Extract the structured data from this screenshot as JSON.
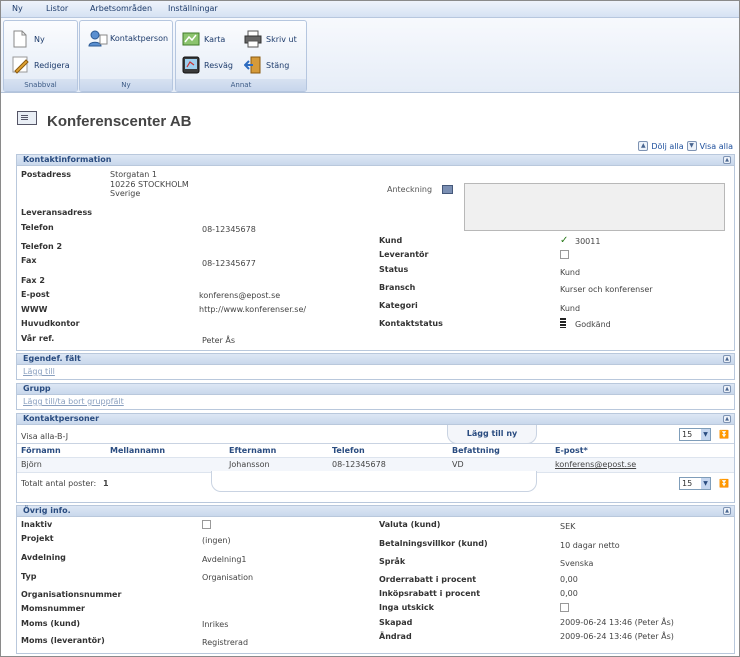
{
  "menu": [
    "Ny",
    "Listor",
    "Arbetsområden",
    "Inställningar"
  ],
  "ribbon": {
    "snabbval": {
      "label": "Snabbval",
      "new": "Ny",
      "edit": "Redigera"
    },
    "ny": {
      "label": "Ny",
      "contact": "Kontaktperson"
    },
    "annat": {
      "label": "Annat",
      "map": "Karta",
      "print": "Skriv ut",
      "route": "Resväg",
      "close": "Stäng"
    }
  },
  "page": {
    "title": "Konferenscenter AB",
    "hide_all": "Dölj alla",
    "show_all": "Visa alla"
  },
  "contact_info": {
    "header": "Kontaktinformation",
    "labels": {
      "postal": "Postadress",
      "delivery": "Leveransadress",
      "phone": "Telefon",
      "phone2": "Telefon 2",
      "fax": "Fax",
      "fax2": "Fax 2",
      "email": "E-post",
      "www": "WWW",
      "hq": "Huvudkontor",
      "ref": "Vår ref.",
      "note": "Anteckning",
      "customer": "Kund",
      "supplier": "Leverantör",
      "status": "Status",
      "industry": "Bransch",
      "category": "Kategori",
      "contact_status": "Kontaktstatus"
    },
    "postal_line1": "Storgatan 1",
    "postal_line2": "10226 STOCKHOLM",
    "postal_line3": "Sverige",
    "phone": "08-12345678",
    "fax": "08-12345677",
    "email": "konferens@epost.se",
    "www": "http://www.konferenser.se/",
    "ref": "Peter Ås",
    "customer_no": "30011",
    "status": "Kund",
    "industry": "Kurser och konferenser",
    "category": "Kund",
    "contact_status": "Godkänd"
  },
  "custom_fields": {
    "header": "Egendef. fält",
    "add": "Lägg till"
  },
  "group": {
    "header": "Grupp",
    "add_remove": "Lägg till/ta bort gruppfält"
  },
  "contacts": {
    "header": "Kontaktpersoner",
    "filter": "Visa alla-B-J",
    "add_new": "Lägg till ny",
    "page_size": "15",
    "columns": [
      "Förnamn",
      "Mellannamn",
      "Efternamn",
      "Telefon",
      "Befattning",
      "E-post*"
    ],
    "rows": [
      {
        "first": "Björn",
        "middle": "",
        "last": "Johansson",
        "phone": "08-12345678",
        "title": "VD",
        "email": "konferens@epost.se"
      }
    ],
    "total_label": "Totalt antal poster:",
    "total": "1"
  },
  "other": {
    "header": "Övrig info.",
    "labels": {
      "inactive": "Inaktiv",
      "project": "Projekt",
      "department": "Avdelning",
      "type": "Typ",
      "orgnr": "Organisationsnummer",
      "vatnr": "Momsnummer",
      "vat_customer": "Moms (kund)",
      "vat_supplier": "Moms (leverantör)",
      "currency": "Valuta (kund)",
      "terms": "Betalningsvillkor (kund)",
      "language": "Språk",
      "order_discount": "Orderrabatt i procent",
      "purchase_discount": "Inköpsrabatt i procent",
      "no_mailings": "Inga utskick",
      "created": "Skapad",
      "changed": "Ändrad"
    },
    "project": "(ingen)",
    "department": "Avdelning1",
    "type": "Organisation",
    "vat_customer": "Inrikes",
    "vat_supplier": "Registrerad",
    "currency": "SEK",
    "terms": "10 dagar netto",
    "language": "Svenska",
    "order_discount": "0,00",
    "purchase_discount": "0,00",
    "created": "2009-06-24 13:46 (Peter Ås)",
    "changed": "2009-06-24 13:46 (Peter Ås)"
  }
}
